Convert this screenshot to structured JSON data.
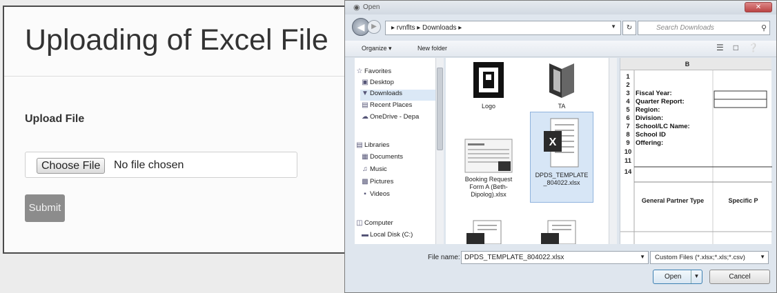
{
  "web": {
    "title": "Uploading of Excel File",
    "upload_label": "Upload File",
    "choose_file": "Choose File",
    "no_file": "No file chosen",
    "submit": "Submit"
  },
  "dialog": {
    "title": "Open",
    "breadcrumb": "▸ rvnflts ▸ Downloads ▸",
    "search_placeholder": "Search Downloads",
    "toolbar": {
      "organize": "Organize ▾",
      "new_folder": "New folder"
    },
    "nav": {
      "favorites": "Favorites",
      "desktop": "Desktop",
      "downloads": "Downloads",
      "recent": "Recent Places",
      "onedrive": "OneDrive - Depa",
      "libraries": "Libraries",
      "documents": "Documents",
      "music": "Music",
      "pictures": "Pictures",
      "videos": "Videos",
      "computer": "Computer",
      "local_disk": "Local Disk (C:)"
    },
    "files": {
      "logo": "Logo",
      "ta": "TA",
      "booking": "Booking Request Form A (Beth-Dipolog).xlsx",
      "dpds": "DPDS_TEMPLATE _804022.xlsx"
    },
    "preview": {
      "col_b": "B",
      "rows": [
        "1",
        "2",
        "3",
        "4",
        "5",
        "6",
        "7",
        "8",
        "9",
        "10",
        "11",
        "14"
      ],
      "labels": {
        "fiscal_year": "Fiscal Year:",
        "quarter": "Quarter Report:",
        "region": "Region:",
        "division": "Division:",
        "school": "School/LC Name:",
        "school_id": "School ID",
        "offering": "Offering:"
      },
      "col_header_1": "General Partner Type",
      "col_header_2": "Specific P"
    },
    "file_name_label": "File name:",
    "file_name_value": "DPDS_TEMPLATE_804022.xlsx",
    "filter": "Custom Files (*.xlsx;*.xls;*.csv)",
    "open": "Open",
    "cancel": "Cancel"
  }
}
